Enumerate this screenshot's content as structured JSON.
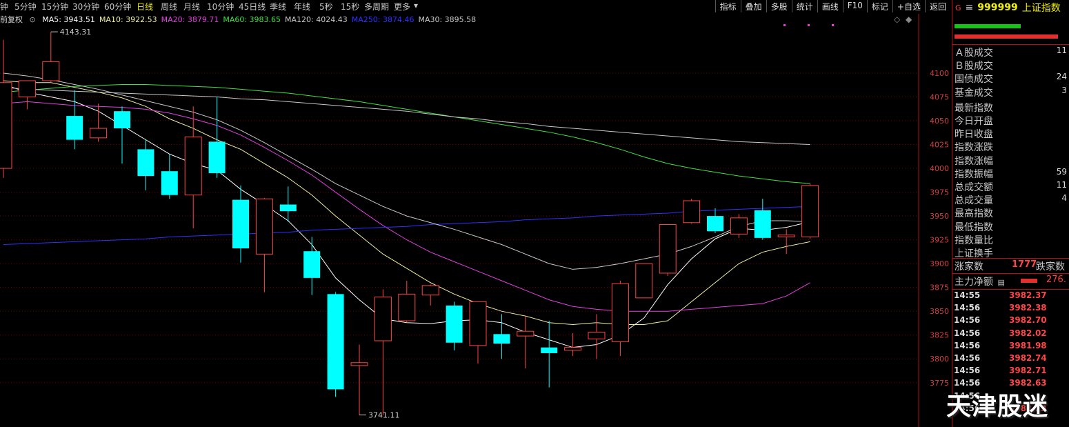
{
  "toolbar": {
    "period_tabs": [
      "钟",
      "5分钟",
      "15分钟",
      "30分钟",
      "60分钟",
      "日线",
      "周线",
      "月线",
      "10分钟",
      "45日线",
      "季线",
      "年线",
      "5秒",
      "15秒",
      "多周期",
      "更多"
    ],
    "active_period": "日线",
    "buttons": [
      "指标",
      "叠加",
      "多股",
      "统计",
      "画线",
      "F10",
      "标记",
      "+自选",
      "返回"
    ]
  },
  "ma_legend": {
    "mode_label": "前复权",
    "items": [
      {
        "text": "MA5: 3943.51",
        "color": "#ffffff"
      },
      {
        "text": "MA10: 3922.53",
        "color": "#f0f0a0"
      },
      {
        "text": "MA20: 3879.71",
        "color": "#e040e0"
      },
      {
        "text": "MA60: 3983.65",
        "color": "#40e040"
      },
      {
        "text": "MA120: 4024.43",
        "color": "#c8c8c8"
      },
      {
        "text": "MA250: 3874.46",
        "color": "#3030ff"
      },
      {
        "text": "MA30: 3895.58",
        "color": "#c8c8c8"
      }
    ]
  },
  "chart_data": {
    "type": "candlestick",
    "ylim": [
      3735,
      4155
    ],
    "y_ticks": [
      3775,
      3800,
      3825,
      3850,
      3875,
      3900,
      3925,
      3950,
      3975,
      4000,
      4025,
      4050,
      4075,
      4100
    ],
    "annotations": [
      {
        "text": "4143.31",
        "x_index": 2,
        "value": 4143.31
      },
      {
        "text": "3741.11",
        "x_index": 15,
        "value": 3741.11
      }
    ],
    "candles": [
      {
        "o": 4000,
        "h": 4135,
        "l": 3990,
        "c": 4090
      },
      {
        "o": 4075,
        "h": 4092,
        "l": 4062,
        "c": 4092
      },
      {
        "o": 4092,
        "h": 4143.31,
        "l": 4090,
        "c": 4112
      },
      {
        "o": 4055,
        "h": 4082,
        "l": 4020,
        "c": 4030
      },
      {
        "o": 4032,
        "h": 4068,
        "l": 4028,
        "c": 4042
      },
      {
        "o": 4060,
        "h": 4065,
        "l": 4005,
        "c": 4042
      },
      {
        "o": 4020,
        "h": 4030,
        "l": 3977,
        "c": 3992
      },
      {
        "o": 3997,
        "h": 4015,
        "l": 3968,
        "c": 3972
      },
      {
        "o": 3972,
        "h": 4065,
        "l": 3937,
        "c": 4033
      },
      {
        "o": 4028,
        "h": 4075,
        "l": 3990,
        "c": 3995
      },
      {
        "o": 3967,
        "h": 3982,
        "l": 3901,
        "c": 3916
      },
      {
        "o": 3910,
        "h": 3969,
        "l": 3870,
        "c": 3968
      },
      {
        "o": 3962,
        "h": 3981,
        "l": 3944,
        "c": 3955
      },
      {
        "o": 3913,
        "h": 3928,
        "l": 3867,
        "c": 3885
      },
      {
        "o": 3868,
        "h": 3870,
        "l": 3760,
        "c": 3768
      },
      {
        "o": 3793,
        "h": 3815,
        "l": 3741.11,
        "c": 3796
      },
      {
        "o": 3819,
        "h": 3873,
        "l": 3741,
        "c": 3865
      },
      {
        "o": 3840,
        "h": 3882,
        "l": 3838,
        "c": 3868
      },
      {
        "o": 3867,
        "h": 3878,
        "l": 3856,
        "c": 3877
      },
      {
        "o": 3856,
        "h": 3860,
        "l": 3809,
        "c": 3817
      },
      {
        "o": 3814,
        "h": 3860,
        "l": 3795,
        "c": 3860
      },
      {
        "o": 3826,
        "h": 3847,
        "l": 3800,
        "c": 3816
      },
      {
        "o": 3824,
        "h": 3845,
        "l": 3790,
        "c": 3829
      },
      {
        "o": 3812,
        "h": 3840,
        "l": 3770,
        "c": 3806
      },
      {
        "o": 3809,
        "h": 3827,
        "l": 3803,
        "c": 3812
      },
      {
        "o": 3821,
        "h": 3847,
        "l": 3800,
        "c": 3828
      },
      {
        "o": 3818,
        "h": 3882,
        "l": 3803,
        "c": 3879
      },
      {
        "o": 3864,
        "h": 3892,
        "l": 3864,
        "c": 3900
      },
      {
        "o": 3890,
        "h": 3941,
        "l": 3887,
        "c": 3941
      },
      {
        "o": 3943,
        "h": 3968,
        "l": 3942,
        "c": 3966
      },
      {
        "o": 3950,
        "h": 3958,
        "l": 3932,
        "c": 3934
      },
      {
        "o": 3931,
        "h": 3952,
        "l": 3927,
        "c": 3948
      },
      {
        "o": 3956,
        "h": 3968,
        "l": 3925,
        "c": 3927
      },
      {
        "o": 3928,
        "h": 3936,
        "l": 3910,
        "c": 3930
      },
      {
        "o": 3928,
        "h": 3984,
        "l": 3926,
        "c": 3982
      }
    ],
    "ma_lines": [
      {
        "name": "MA5",
        "color": "#ffffff",
        "values": [
          4088,
          4080,
          4075,
          4070,
          4060,
          4045,
          4030,
          4015,
          4005,
          3998,
          3978,
          3962,
          3945,
          3920,
          3885,
          3862,
          3842,
          3838,
          3837,
          3840,
          3841,
          3838,
          3828,
          3820,
          3812,
          3815,
          3825,
          3843,
          3878,
          3905,
          3926,
          3937,
          3935,
          3938,
          3944
        ]
      },
      {
        "name": "MA10",
        "color": "#f0f0a0",
        "values": [
          4092,
          4090,
          4090,
          4085,
          4080,
          4074,
          4065,
          4052,
          4042,
          4030,
          4020,
          4005,
          3990,
          3972,
          3950,
          3930,
          3910,
          3895,
          3880,
          3868,
          3858,
          3850,
          3845,
          3838,
          3836,
          3838,
          3836,
          3836,
          3840,
          3860,
          3880,
          3900,
          3912,
          3918,
          3923
        ]
      },
      {
        "name": "MA20",
        "color": "#e040e0",
        "values": [
          4068,
          4070,
          4068,
          4066,
          4065,
          4064,
          4062,
          4058,
          4052,
          4045,
          4035,
          4022,
          4008,
          3993,
          3975,
          3957,
          3940,
          3925,
          3912,
          3902,
          3892,
          3882,
          3872,
          3862,
          3855,
          3852,
          3850,
          3850,
          3850,
          3852,
          3854,
          3856,
          3858,
          3866,
          3880
        ]
      },
      {
        "name": "MA60",
        "color": "#40e040",
        "values": [
          4080,
          4082,
          4084,
          4086,
          4087,
          4088,
          4088,
          4087,
          4086,
          4085,
          4083,
          4081,
          4079,
          4076,
          4073,
          4070,
          4066,
          4062,
          4058,
          4054,
          4050,
          4046,
          4042,
          4038,
          4033,
          4027,
          4020,
          4012,
          4005,
          4000,
          3996,
          3992,
          3989,
          3986,
          3984
        ]
      },
      {
        "name": "MA120",
        "color": "#c8c8c8",
        "values": [
          4085,
          4083,
          4082,
          4081,
          4080,
          4079,
          4078,
          4077,
          4076,
          4075,
          4073,
          4072,
          4070,
          4068,
          4066,
          4064,
          4062,
          4060,
          4057,
          4054,
          4052,
          4049,
          4047,
          4044,
          4042,
          4040,
          4038,
          4036,
          4034,
          4032,
          4030,
          4028,
          4027,
          4026,
          4025
        ]
      },
      {
        "name": "MA250",
        "color": "#3030ff",
        "values": [
          3920,
          3921,
          3922,
          3923,
          3924,
          3925,
          3926,
          3928,
          3929,
          3930,
          3931,
          3932,
          3933,
          3935,
          3936,
          3937,
          3938,
          3939,
          3941,
          3942,
          3943,
          3944,
          3946,
          3947,
          3948,
          3950,
          3951,
          3952,
          3953,
          3955,
          3956,
          3957,
          3958,
          3959,
          3960
        ]
      },
      {
        "name": "MA30",
        "color": "#c8c8c8",
        "values": [
          4100,
          4097,
          4093,
          4088,
          4083,
          4077,
          4071,
          4065,
          4059,
          4051,
          4040,
          4027,
          4013,
          3999,
          3984,
          3972,
          3960,
          3950,
          3943,
          3936,
          3928,
          3920,
          3910,
          3900,
          3894,
          3896,
          3900,
          3905,
          3910,
          3918,
          3928,
          3939,
          3945,
          3945,
          3944
        ]
      }
    ]
  },
  "right_panel": {
    "flag": "G",
    "menu_glyph": "≡",
    "code": "999999",
    "name": "上证指数",
    "colors": {
      "up": "#ff4545",
      "down": "#00ffff",
      "green_bar": "#16c416",
      "red_bar": "#e03030"
    },
    "rows": [
      {
        "label": "Ａ股成交",
        "value": "11"
      },
      {
        "label": "Ｂ股成交",
        "value": ""
      },
      {
        "label": "国债成交",
        "value": "24"
      },
      {
        "label": "基金成交",
        "value": "3"
      },
      {
        "label": "最新指数",
        "value": ""
      },
      {
        "label": "今日开盘",
        "value": ""
      },
      {
        "label": "昨日收盘",
        "value": ""
      },
      {
        "label": "指数涨跌",
        "value": ""
      },
      {
        "label": "指数涨幅",
        "value": ""
      },
      {
        "label": "指数振幅",
        "value": "59"
      },
      {
        "label": "总成交额",
        "value": "11"
      },
      {
        "label": "总成交量",
        "value": "4"
      },
      {
        "label": "最高指数",
        "value": ""
      },
      {
        "label": "最低指数",
        "value": ""
      },
      {
        "label": "指数量比",
        "value": ""
      },
      {
        "label": "上证换手",
        "value": ""
      }
    ],
    "breadth": {
      "up_label": "涨家数",
      "up_value": "1777",
      "down_label": "跌家数"
    },
    "main_force": {
      "label": "主力净额",
      "value": "276."
    },
    "ticks": [
      {
        "t": "14:55",
        "p": "3982.37"
      },
      {
        "t": "14:56",
        "p": "3982.38"
      },
      {
        "t": "14:56",
        "p": "3982.70"
      },
      {
        "t": "14:56",
        "p": "3982.02"
      },
      {
        "t": "14:56",
        "p": "3981.98"
      },
      {
        "t": "14:56",
        "p": "3982.74"
      },
      {
        "t": "14:56",
        "p": "3982.71"
      },
      {
        "t": "14:56",
        "p": "3982.63"
      },
      {
        "t": "14:56",
        "p": ""
      },
      {
        "t": "14:56",
        "p": "3983.22"
      }
    ]
  },
  "watermark": "天津股迷"
}
